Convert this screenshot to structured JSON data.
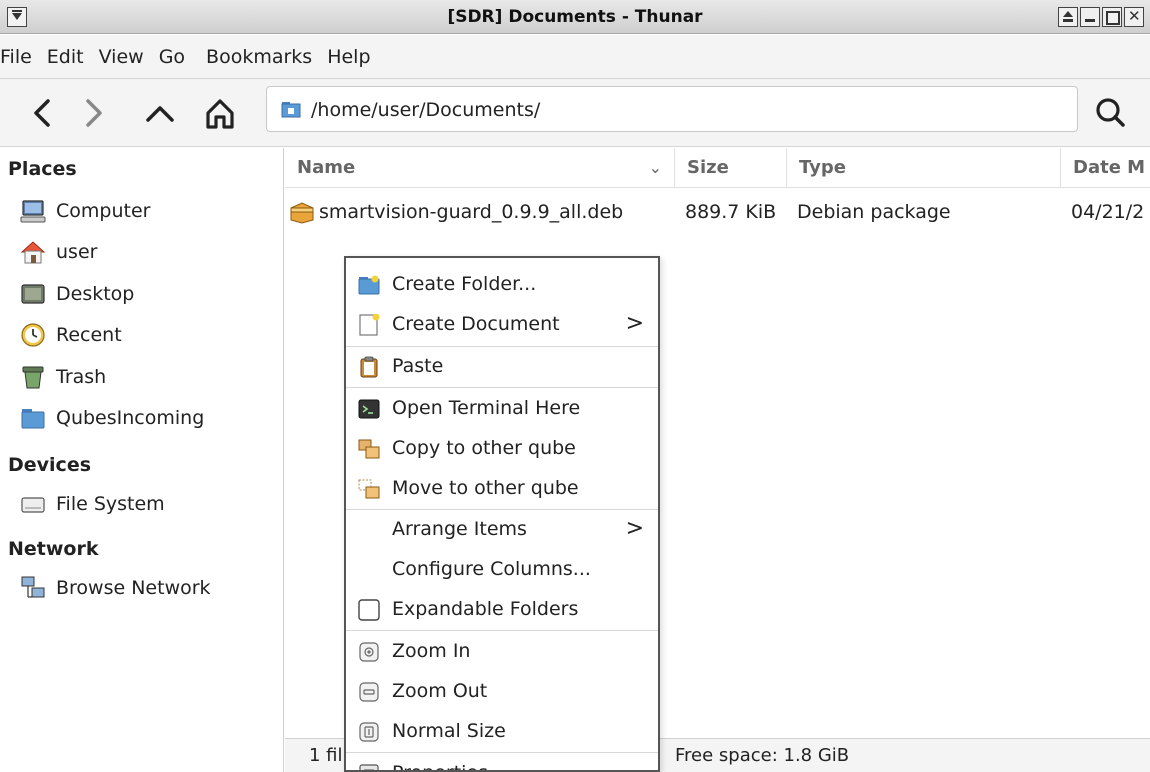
{
  "window": {
    "title": "[SDR] Documents - Thunar"
  },
  "menubar": {
    "items": [
      "File",
      "Edit",
      "View",
      "Go",
      "Bookmarks",
      "Help"
    ]
  },
  "toolbar": {
    "path": "/home/user/Documents/",
    "icons": [
      "back-icon",
      "forward-icon",
      "up-icon",
      "home-icon",
      "search-icon"
    ]
  },
  "sidebar": {
    "places_header": "Places",
    "places": [
      {
        "label": "Computer",
        "icon": "computer-icon"
      },
      {
        "label": "user",
        "icon": "home-folder-icon"
      },
      {
        "label": "Desktop",
        "icon": "desktop-icon"
      },
      {
        "label": "Recent",
        "icon": "recent-icon"
      },
      {
        "label": "Trash",
        "icon": "trash-icon"
      },
      {
        "label": "QubesIncoming",
        "icon": "folder-icon"
      }
    ],
    "devices_header": "Devices",
    "devices": [
      {
        "label": "File System",
        "icon": "drive-icon"
      }
    ],
    "network_header": "Network",
    "network": [
      {
        "label": "Browse Network",
        "icon": "network-icon"
      }
    ]
  },
  "filelist": {
    "columns": {
      "name": "Name",
      "size": "Size",
      "type": "Type",
      "date": "Date M"
    },
    "rows": [
      {
        "name": "smartvision-guard_0.9.9_all.deb",
        "size": "889.7 KiB",
        "type": "Debian package",
        "date": "04/21/2"
      }
    ]
  },
  "statusbar": {
    "left": "1 fil",
    "right": "Free space: 1.8 GiB"
  },
  "context_menu": {
    "items": [
      {
        "label": "Create Folder...",
        "icon": "new-folder-icon"
      },
      {
        "label": "Create Document",
        "icon": "new-document-icon",
        "submenu": true
      },
      {
        "label": "Paste",
        "icon": "paste-icon"
      },
      {
        "label": "Open Terminal Here",
        "icon": "terminal-icon"
      },
      {
        "label": "Copy to other qube",
        "icon": "copy-qube-icon"
      },
      {
        "label": "Move to other qube",
        "icon": "move-qube-icon"
      },
      {
        "label": "Arrange Items",
        "icon": "",
        "submenu": true
      },
      {
        "label": "Configure Columns...",
        "icon": ""
      },
      {
        "label": "Expandable Folders",
        "icon": "checkbox-icon",
        "checked": false
      },
      {
        "label": "Zoom In",
        "icon": "zoom-in-icon"
      },
      {
        "label": "Zoom Out",
        "icon": "zoom-out-icon"
      },
      {
        "label": "Normal Size",
        "icon": "zoom-normal-icon"
      },
      {
        "label": "Properties",
        "icon": "properties-icon"
      }
    ],
    "submenu_chevron": ">"
  },
  "colors": {
    "bar_bg": "#f4f4f4",
    "folder_blue": "#5b9bd5",
    "home_orange": "#e8553a"
  }
}
